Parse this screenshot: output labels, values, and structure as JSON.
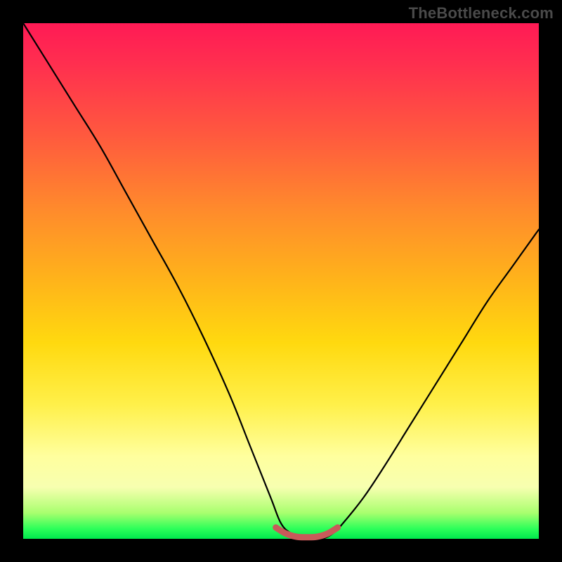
{
  "watermark": "TheBottleneck.com",
  "chart_data": {
    "type": "line",
    "title": "",
    "xlabel": "",
    "ylabel": "",
    "xlim": [
      0,
      100
    ],
    "ylim": [
      0,
      100
    ],
    "grid": false,
    "series": [
      {
        "name": "bottleneck-curve",
        "color": "#000000",
        "x": [
          0,
          5,
          10,
          15,
          20,
          25,
          30,
          35,
          40,
          44,
          48,
          50,
          52,
          54,
          56,
          58,
          60,
          62,
          66,
          70,
          75,
          80,
          85,
          90,
          95,
          100
        ],
        "y": [
          100,
          92,
          84,
          76,
          67,
          58,
          49,
          39,
          28,
          18,
          8,
          3,
          1,
          0,
          0,
          0,
          1,
          3,
          8,
          14,
          22,
          30,
          38,
          46,
          53,
          60
        ]
      },
      {
        "name": "optimal-band",
        "color": "#c85a5a",
        "x": [
          49,
          51,
          53,
          55,
          57,
          59,
          61
        ],
        "y": [
          2.2,
          1.0,
          0.4,
          0.3,
          0.4,
          1.0,
          2.2
        ]
      }
    ]
  },
  "colors": {
    "frame": "#000000",
    "gradient_top": "#ff1a55",
    "gradient_bottom": "#00e84d",
    "curve": "#000000",
    "band": "#c85a5a",
    "watermark": "#4a4a4a"
  }
}
